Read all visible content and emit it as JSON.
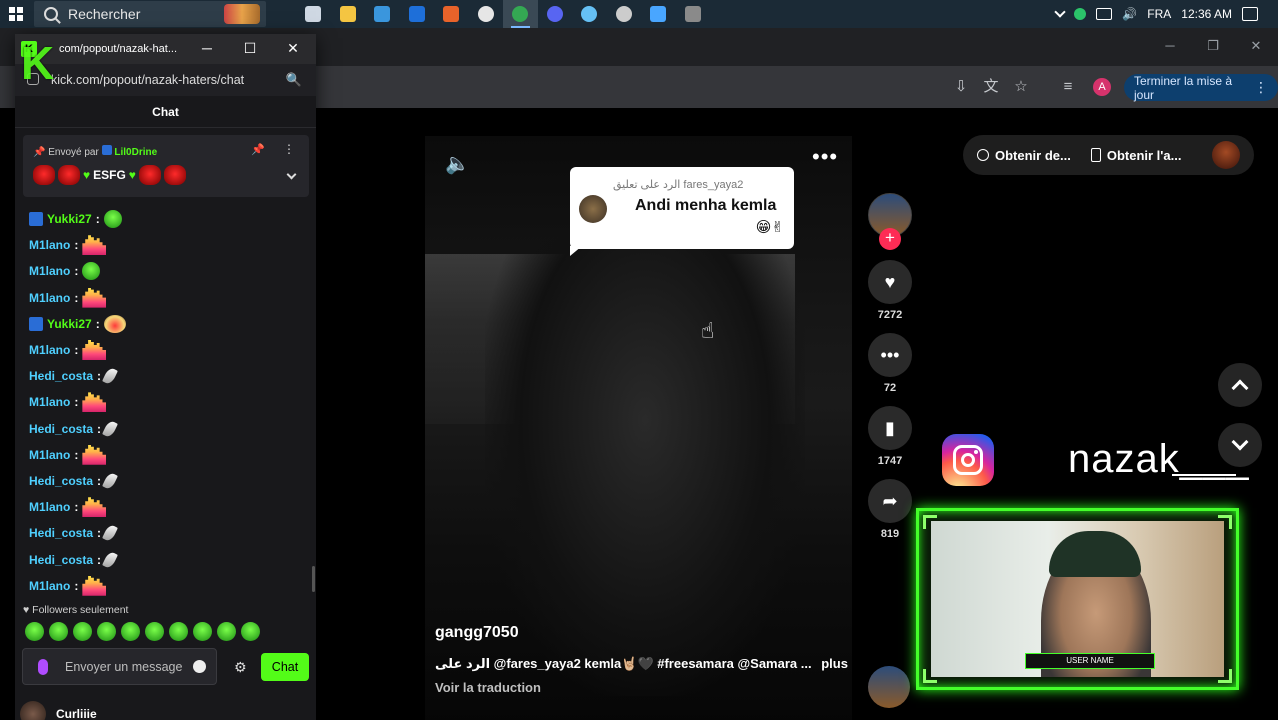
{
  "taskbar": {
    "search_placeholder": "Rechercher",
    "language": "FRA",
    "clock": "12:36 AM",
    "apps": [
      {
        "name": "task-view",
        "color": "#cfd8e3"
      },
      {
        "name": "file-explorer",
        "color": "#f4c542"
      },
      {
        "name": "microsoft-store",
        "color": "#3a96dd"
      },
      {
        "name": "outlook",
        "color": "#1e6fd9"
      },
      {
        "name": "office",
        "color": "#e8632a"
      },
      {
        "name": "obs",
        "color": "#e6e6e6"
      },
      {
        "name": "chrome",
        "color": "#34a853"
      },
      {
        "name": "discord",
        "color": "#5865f2"
      },
      {
        "name": "steam",
        "color": "#66c0f4"
      },
      {
        "name": "clock-app",
        "color": "#cccccc"
      },
      {
        "name": "app-blue",
        "color": "#49a6ff"
      },
      {
        "name": "app-grey",
        "color": "#8a8a8a"
      }
    ]
  },
  "browser": {
    "update_button": "Terminer la mise à jour",
    "profile_initial": "A"
  },
  "kick": {
    "window_title": "com/popout/nazak-hat...",
    "url": "kick.com/popout/nazak-haters/chat",
    "header": "Chat",
    "pinned": {
      "sent_by_label": "Envoyé par",
      "sent_by_user": "Lil0Drine",
      "message": "ESFG"
    },
    "messages": [
      {
        "user": "Yukki27",
        "badge": true,
        "emote": "green"
      },
      {
        "user": "M1lano",
        "badge": false,
        "emote": "bars"
      },
      {
        "user": "M1lano",
        "badge": false,
        "emote": "green"
      },
      {
        "user": "M1lano",
        "badge": false,
        "emote": "bars"
      },
      {
        "user": "Yukki27",
        "badge": true,
        "emote": "face"
      },
      {
        "user": "M1lano",
        "badge": false,
        "emote": "bars"
      },
      {
        "user": "Hedi_costa",
        "badge": false,
        "emote": "feather"
      },
      {
        "user": "M1lano",
        "badge": false,
        "emote": "bars"
      },
      {
        "user": "Hedi_costa",
        "badge": false,
        "emote": "feather"
      },
      {
        "user": "M1lano",
        "badge": false,
        "emote": "bars"
      },
      {
        "user": "Hedi_costa",
        "badge": false,
        "emote": "feather"
      },
      {
        "user": "M1lano",
        "badge": false,
        "emote": "bars"
      },
      {
        "user": "Hedi_costa",
        "badge": false,
        "emote": "feather"
      },
      {
        "user": "Hedi_costa",
        "badge": false,
        "emote": "feather"
      },
      {
        "user": "M1lano",
        "badge": false,
        "emote": "bars"
      }
    ],
    "followers_mode": "Followers seulement",
    "input_placeholder": "Envoyer un message",
    "send_label": "Chat",
    "below_user": "Curliiie"
  },
  "tiktok": {
    "pill": {
      "item1": "Obtenir de...",
      "item2": "Obtenir l'a..."
    },
    "reply_card": {
      "header": "الرد على تعليق fares_yaya2",
      "text": "Andi menha kemla",
      "emoji": "😁✌"
    },
    "author": "gangg7050",
    "caption": "الرد على @fares_yaya2  kemla🤘🏼🖤 #freesamara @Samara ...",
    "more": "plus",
    "translate": "Voir la traduction",
    "progress": 0.04,
    "likes": "7272",
    "comments": "72",
    "saves": "1747",
    "shares": "819"
  },
  "overlay": {
    "instagram_handle": "nazak___",
    "webcam_label": "USER NAME",
    "accent": "#44ff2a"
  }
}
